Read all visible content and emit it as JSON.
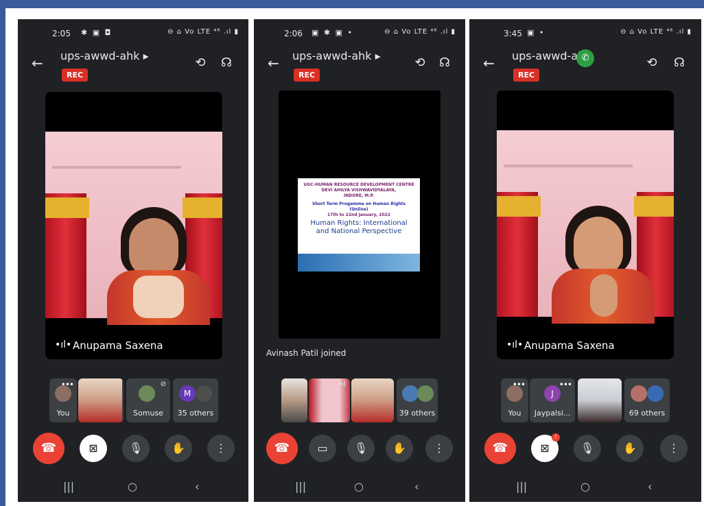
{
  "phones": [
    {
      "status_time": "2:05",
      "status_icons_left": "✱ ▣ ◘",
      "status_icons_right": "⊖ ⌂ Vo LTE ⁴⁶ .ıl ▮",
      "room": "ups-awwd-ahk ▸",
      "rec": "REC",
      "main_speaker": "Anupama Saxena",
      "thumbs": [
        {
          "label": "You",
          "kind": "avatar",
          "letter": "",
          "color": "#5f6368"
        },
        {
          "label": "",
          "kind": "video"
        },
        {
          "label": "Somuse",
          "kind": "avatar",
          "letter": "",
          "color": "#5f6368"
        },
        {
          "label": "35 others",
          "kind": "avatar",
          "letter": "M",
          "color": "#673ab7"
        }
      ],
      "controls": [
        "end-call",
        "camera-off",
        "mic",
        "raise-hand",
        "more"
      ],
      "nav": [
        "|||",
        "○",
        "‹"
      ]
    },
    {
      "status_time": "2:06",
      "status_icons_left": "▣ ✱ ▣ •",
      "status_icons_right": "⊖ ⌂ Vo LTE ⁴⁶ .ıl ▮",
      "room": "ups-awwd-ahk ▸",
      "rec": "REC",
      "slide": {
        "line1": "UGC-HUMAN RESOURCE DEVELOPMENT CENTRE",
        "line2": "DEVI AHILYA VISHWAVIDYALAYA,",
        "line3": "INDORE, M.P.",
        "line4": "Short Term Progamme on Human Rights",
        "line5": "(Online)",
        "line6": "17th to 22nd January, 2022",
        "title1": "Human Rights: International",
        "title2": "and National Perspective"
      },
      "joined_text": "Avinash Patil joined",
      "thumbs": [
        {
          "label": "",
          "kind": "video"
        },
        {
          "label": "",
          "kind": "video"
        },
        {
          "label": "",
          "kind": "video"
        },
        {
          "label": "39 others",
          "kind": "avatar",
          "letter": "",
          "color": "#5f6368"
        }
      ],
      "controls": [
        "end-call",
        "camera-on",
        "mic",
        "raise-hand",
        "more"
      ],
      "nav": [
        "|||",
        "○",
        "‹"
      ]
    },
    {
      "status_time": "3:45",
      "status_icons_left": "▣  •",
      "status_icons_right": "⊖ ⌂ Vo LTE ⁴⁶ .ıl ▮",
      "room": "ups-awwd-ah ▸",
      "rec": "REC",
      "main_speaker": "Anupama Saxena",
      "thumbs": [
        {
          "label": "You",
          "kind": "avatar",
          "letter": "",
          "color": "#5f6368"
        },
        {
          "label": "Jaypalsi...",
          "kind": "avatar",
          "letter": "J",
          "color": "#8e44ad"
        },
        {
          "label": "",
          "kind": "video"
        },
        {
          "label": "69 others",
          "kind": "avatar",
          "letter": "",
          "color": "#5f6368"
        }
      ],
      "controls": [
        "end-call",
        "camera-off",
        "mic",
        "raise-hand",
        "more"
      ],
      "nav": [
        "|||",
        "○",
        "‹"
      ]
    }
  ]
}
